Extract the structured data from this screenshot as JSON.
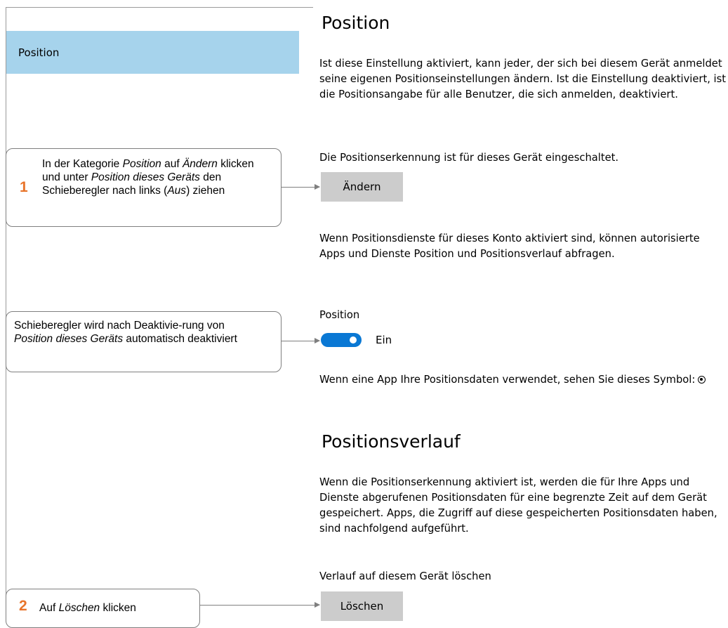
{
  "nav": {
    "selected_label": "Position"
  },
  "position_section": {
    "title": "Position",
    "description": "Ist diese Einstellung aktiviert, kann jeder, der sich bei diesem Gerät anmeldet seine eigenen Positionseinstellungen ändern. Ist die Einstellung deaktiviert, ist die Positionsangabe für alle Benutzer, die sich anmelden, deaktiviert.",
    "device_status": "Die Positionserkennung ist für dieses Gerät eingeschaltet.",
    "change_button": "Ändern",
    "account_description": "Wenn Positionsdienste für dieses Konto aktiviert sind, können autorisierte Apps und Dienste Position und Positionsverlauf abfragen.",
    "toggle_title": "Position",
    "toggle_state": "Ein",
    "toggle_on": true,
    "symbol_text": "Wenn eine App Ihre Positionsdaten verwendet, sehen Sie dieses Symbol:",
    "symbol_icon": "location-in-use-icon"
  },
  "history_section": {
    "title": "Positionsverlauf",
    "description": "Wenn die Positionserkennung aktiviert ist, werden die für Ihre Apps und Dienste abgerufenen Positionsdaten für eine begrenzte Zeit auf dem Gerät gespeichert. Apps, die Zugriff auf diese gespeicherten Positionsdaten haben, sind nachfolgend aufgeführt.",
    "clear_label": "Verlauf auf diesem Gerät löschen",
    "clear_button": "Löschen"
  },
  "callouts": {
    "step1_number": "1",
    "step1_a": "In der Kategorie ",
    "step1_b": "Position",
    "step1_c": " auf ",
    "step1_d": "Ändern",
    "step1_e": " klicken und unter ",
    "step1_f": "Position dieses Geräts",
    "step1_g": " den Schieberegler nach links (",
    "step1_h": "Aus",
    "step1_i": ") ziehen",
    "note_a": "Schieberegler wird nach Deaktivie-rung von ",
    "note_b": "Position dieses Geräts",
    "note_c": " automatisch deaktiviert",
    "step2_number": "2",
    "step2_a": "Auf ",
    "step2_b": "Löschen",
    "step2_c": " klicken"
  },
  "colors": {
    "nav_selected": "#a6d3ec",
    "toggle_on": "#0a78d4",
    "button": "#cccccc",
    "step_number": "#e8742a"
  }
}
